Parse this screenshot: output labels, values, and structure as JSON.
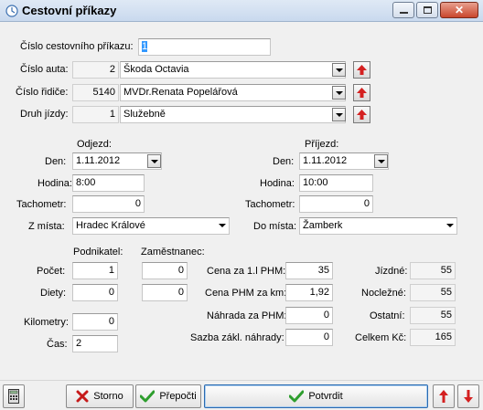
{
  "window": {
    "title": "Cestovní příkazy"
  },
  "header": {
    "order_number_label": "Číslo cestovního příkazu:",
    "order_number_value": "1"
  },
  "car": {
    "label": "Číslo auta:",
    "id": "2",
    "name": "Škoda Octavia"
  },
  "driver": {
    "label": "Číslo řidiče:",
    "id": "5140",
    "name": "MVDr.Renata Popelářová"
  },
  "trip_type": {
    "label": "Druh jízdy:",
    "id": "1",
    "name": "Služebně"
  },
  "departure": {
    "heading": "Odjezd:",
    "day_label": "Den:",
    "day": "1.11.2012",
    "hour_label": "Hodina:",
    "hour": "8:00",
    "odometer_label": "Tachometr:",
    "odometer": "0",
    "place_label": "Z místa:",
    "place": "Hradec Králové"
  },
  "arrival": {
    "heading": "Příjezd:",
    "day_label": "Den:",
    "day": "1.11.2012",
    "hour_label": "Hodina:",
    "hour": "10:00",
    "odometer_label": "Tachometr:",
    "odometer": "0",
    "place_label": "Do místa:",
    "place": "Žamberk"
  },
  "allowances": {
    "entrepreneur_heading": "Podnikatel:",
    "employee_heading": "Zaměstnanec:",
    "count_label": "Počet:",
    "count_entrepreneur": "1",
    "count_employee": "0",
    "diets_label": "Diety:",
    "diets_entrepreneur": "0",
    "diets_employee": "0",
    "km_label": "Kilometry:",
    "km": "0",
    "time_label": "Čas:",
    "time": "2"
  },
  "fuel": {
    "price_label": "Cena za 1.l PHM:",
    "price": "35",
    "per_km_label": "Cena PHM za km:",
    "per_km": "1,92",
    "comp_label": "Náhrada za PHM:",
    "comp": "0",
    "base_rate_label": "Sazba zákl. náhrady:",
    "base_rate": "0"
  },
  "totals": {
    "travel_label": "Jízdné:",
    "travel": "55",
    "lodging_label": "Nocležné:",
    "lodging": "55",
    "other_label": "Ostatní:",
    "other": "55",
    "total_label": "Celkem Kč:",
    "total": "165"
  },
  "buttons": {
    "cancel": "Storno",
    "recalc": "Přepočti",
    "confirm": "Potvrdit"
  },
  "colors": {
    "red_arrow": "#d42020",
    "green_check": "#2e9e2e",
    "cancel_x": "#c61a1a"
  }
}
